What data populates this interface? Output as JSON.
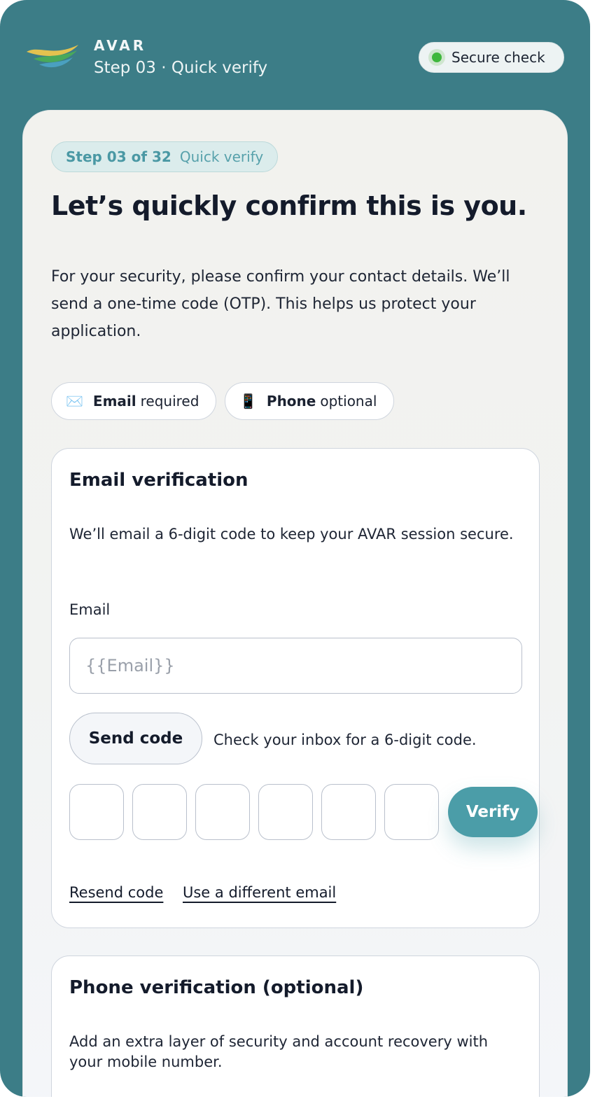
{
  "header": {
    "brand": "AVAR",
    "subtitle": "Step 03 · Quick verify",
    "secure_label": "Secure check"
  },
  "step_pill": {
    "step": "Step 03 of 32",
    "label": "Quick verify"
  },
  "headline": "Let’s quickly confirm this is you.",
  "intro": "For your security, please confirm your contact details. We’ll send a one-time code (OTP). This helps us protect your application.",
  "chips": {
    "email": {
      "icon": "✉️",
      "strong": "Email",
      "rest": "required"
    },
    "phone": {
      "icon": "📱",
      "strong": "Phone",
      "rest": "optional"
    }
  },
  "email_panel": {
    "title": "Email verification",
    "description": "We’ll email a 6-digit code to keep your AVAR session secure.",
    "field_label": "Email",
    "input_placeholder": "{{Email}}",
    "input_value": "",
    "send_button": "Send code",
    "send_hint": "Check your inbox for a 6-digit code.",
    "otp_digits": [
      "",
      "",
      "",
      "",
      "",
      ""
    ],
    "verify_button": "Verify",
    "resend_link": "Resend code",
    "different_email_link": "Use a different email"
  },
  "phone_panel": {
    "title": "Phone verification (optional)",
    "description": "Add an extra layer of security and account recovery with your mobile number."
  },
  "colors": {
    "background": "#3c7d87",
    "accent": "#4b9da8",
    "secure_dot": "#3fb73d",
    "text_dark": "#141b2b"
  }
}
